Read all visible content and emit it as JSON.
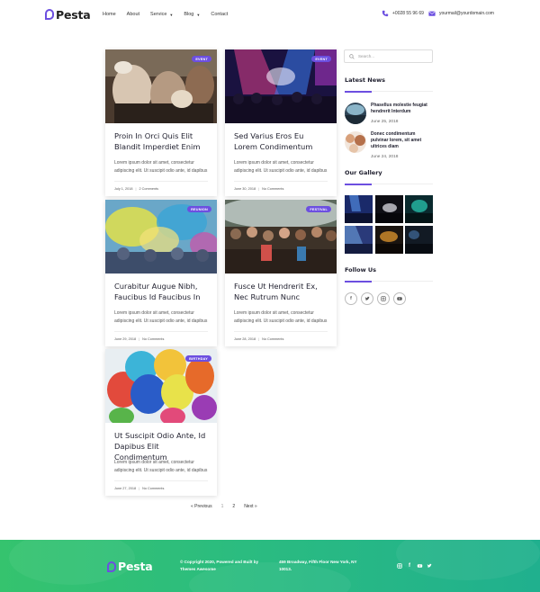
{
  "header": {
    "logo": "Pesta",
    "nav": [
      {
        "label": "Home",
        "caret": false
      },
      {
        "label": "About",
        "caret": false
      },
      {
        "label": "Service",
        "caret": true
      },
      {
        "label": "Blog",
        "caret": true
      },
      {
        "label": "Contact",
        "caret": false
      }
    ],
    "phone": "+0028 55 96 69",
    "email": "yourmail@yourdomain.com"
  },
  "posts": [
    {
      "badge": "EVENT",
      "title": "Proin In Orci Quis Elit Blandit Imperdiet Enim",
      "excerpt": "Lorem ipsum dolor sit amet, consectetur adipiscing elit. Ut suscipit odio ante, id dapibus",
      "date": "July 1, 2018",
      "comments": "2 Comments"
    },
    {
      "badge": "EVENT",
      "title": "Sed Varius Eros Eu Lorem Condimentum",
      "excerpt": "Lorem ipsum dolor sit amet, consectetur adipiscing elit. Ut suscipit odio ante, id dapibus",
      "date": "June 30, 2018",
      "comments": "No Comments"
    },
    {
      "badge": "REUNION",
      "title": "Curabitur Augue Nibh, Faucibus Id Faucibus In",
      "excerpt": "Lorem ipsum dolor sit amet, consectetur adipiscing elit. Ut suscipit odio ante, id dapibus",
      "date": "June 29, 2018",
      "comments": "No Comments"
    },
    {
      "badge": "FESTIVAL",
      "title": "Fusce Ut Hendrerit Ex, Nec Rutrum Nunc",
      "excerpt": "Lorem ipsum dolor sit amet, consectetur adipiscing elit. Ut suscipit odio ante, id dapibus",
      "date": "June 28, 2018",
      "comments": "No Comments"
    },
    {
      "badge": "BIRTHDAY",
      "title": "Ut Suscipit Odio Ante, Id Dapibus Elit Condimentum",
      "excerpt": "Lorem ipsum dolor sit amet, consectetur adipiscing elit. Ut suscipit odio ante, id dapibus",
      "date": "June 27, 2018",
      "comments": "No Comments"
    }
  ],
  "sidebar": {
    "search_placeholder": "Search...",
    "latest_news_title": "Latest News",
    "news": [
      {
        "title": "Phasellus molestie feugiat hendrerit Interdum",
        "date": "June 25, 2018"
      },
      {
        "title": "Donec condimentum pulvinar lorem, sit amet ultrices diam",
        "date": "June 24, 2018"
      }
    ],
    "gallery_title": "Our Gallery",
    "follow_title": "Follow Us",
    "socials": [
      "facebook-icon",
      "twitter-icon",
      "instagram-icon",
      "youtube-icon"
    ]
  },
  "pagination": {
    "previous": "« Previous",
    "pages": [
      "1",
      "2"
    ],
    "next": "Next »"
  },
  "footer": {
    "logo": "Pesta",
    "copyright": "© Copyright 2020, Powered and Built by Themes Awesome",
    "address": "459 Broadway, Fifth Floor New York, NY 10013."
  },
  "colors": {
    "accent": "#6c4fe0",
    "footer": "#2bbc80"
  }
}
